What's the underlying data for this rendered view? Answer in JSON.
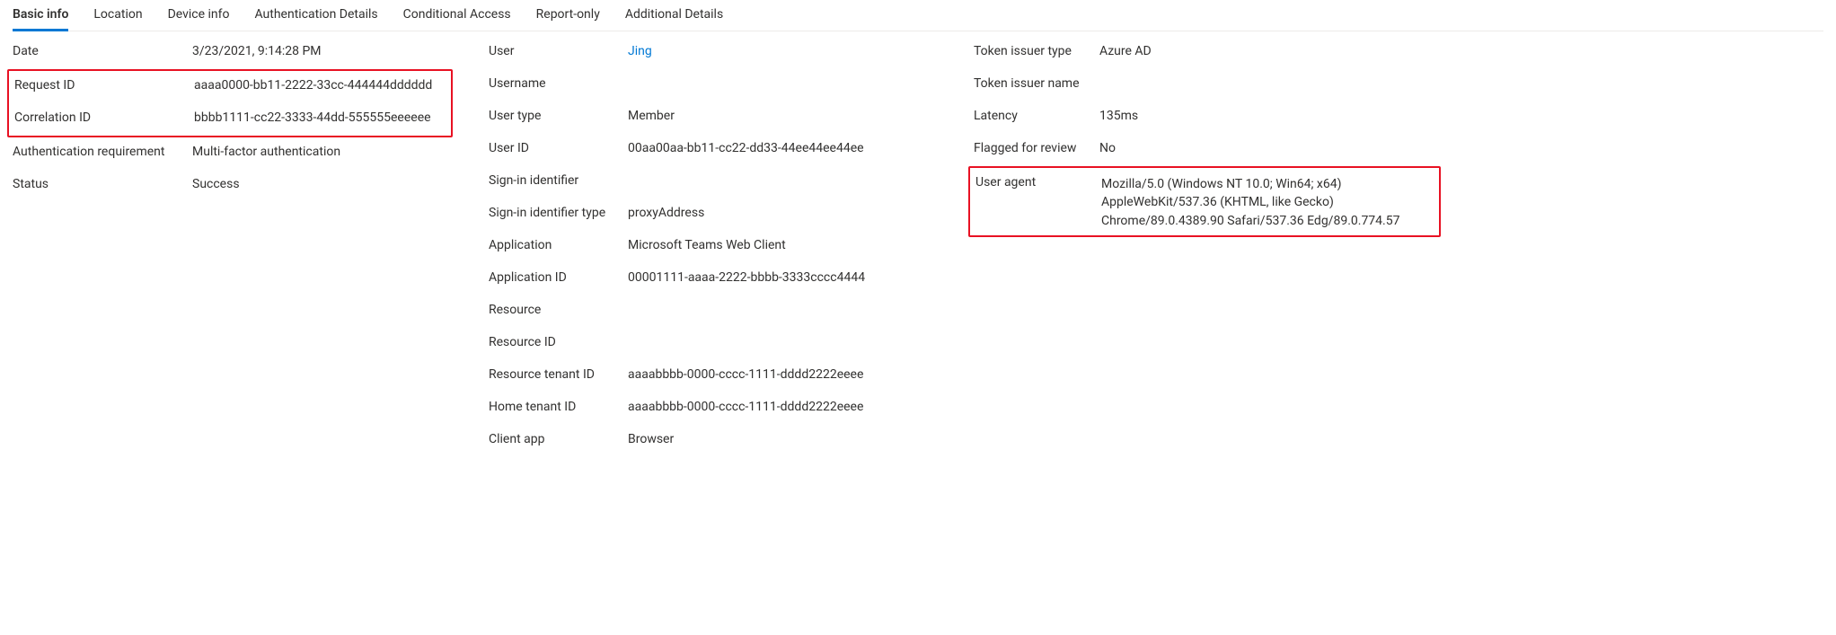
{
  "tabs": {
    "basic_info": "Basic info",
    "location": "Location",
    "device_info": "Device info",
    "auth_details": "Authentication Details",
    "cond_access": "Conditional Access",
    "report_only": "Report-only",
    "add_details": "Additional Details"
  },
  "c1": {
    "date": {
      "label": "Date",
      "value": "3/23/2021, 9:14:28 PM"
    },
    "request_id": {
      "label": "Request ID",
      "value": "aaaa0000-bb11-2222-33cc-444444dddddd"
    },
    "correlation_id": {
      "label": "Correlation ID",
      "value": "bbbb1111-cc22-3333-44dd-555555eeeeee"
    },
    "auth_req": {
      "label": "Authentication requirement",
      "value": "Multi-factor authentication"
    },
    "status": {
      "label": "Status",
      "value": "Success"
    }
  },
  "c2": {
    "user": {
      "label": "User",
      "value": "Jing"
    },
    "username": {
      "label": "Username",
      "value": ""
    },
    "user_type": {
      "label": "User type",
      "value": "Member"
    },
    "user_id": {
      "label": "User ID",
      "value": "00aa00aa-bb11-cc22-dd33-44ee44ee44ee"
    },
    "signin_id": {
      "label": "Sign-in identifier",
      "value": ""
    },
    "signin_id_type": {
      "label": "Sign-in identifier type",
      "value": "proxyAddress"
    },
    "application": {
      "label": "Application",
      "value": "Microsoft Teams Web Client"
    },
    "application_id": {
      "label": "Application ID",
      "value": "00001111-aaaa-2222-bbbb-3333cccc4444"
    },
    "resource": {
      "label": "Resource",
      "value": ""
    },
    "resource_id": {
      "label": "Resource ID",
      "value": ""
    },
    "res_tenant_id": {
      "label": "Resource tenant ID",
      "value": "aaaabbbb-0000-cccc-1111-dddd2222eeee"
    },
    "home_tenant_id": {
      "label": "Home tenant ID",
      "value": "aaaabbbb-0000-cccc-1111-dddd2222eeee"
    },
    "client_app": {
      "label": "Client app",
      "value": "Browser"
    }
  },
  "c3": {
    "issuer_type": {
      "label": "Token issuer type",
      "value": "Azure AD"
    },
    "issuer_name": {
      "label": "Token issuer name",
      "value": ""
    },
    "latency": {
      "label": "Latency",
      "value": "135ms"
    },
    "flagged": {
      "label": "Flagged for review",
      "value": "No"
    },
    "user_agent": {
      "label": "User agent",
      "value": "Mozilla/5.0 (Windows NT 10.0; Win64; x64) AppleWebKit/537.36 (KHTML, like Gecko) Chrome/89.0.4389.90 Safari/537.36 Edg/89.0.774.57"
    }
  }
}
